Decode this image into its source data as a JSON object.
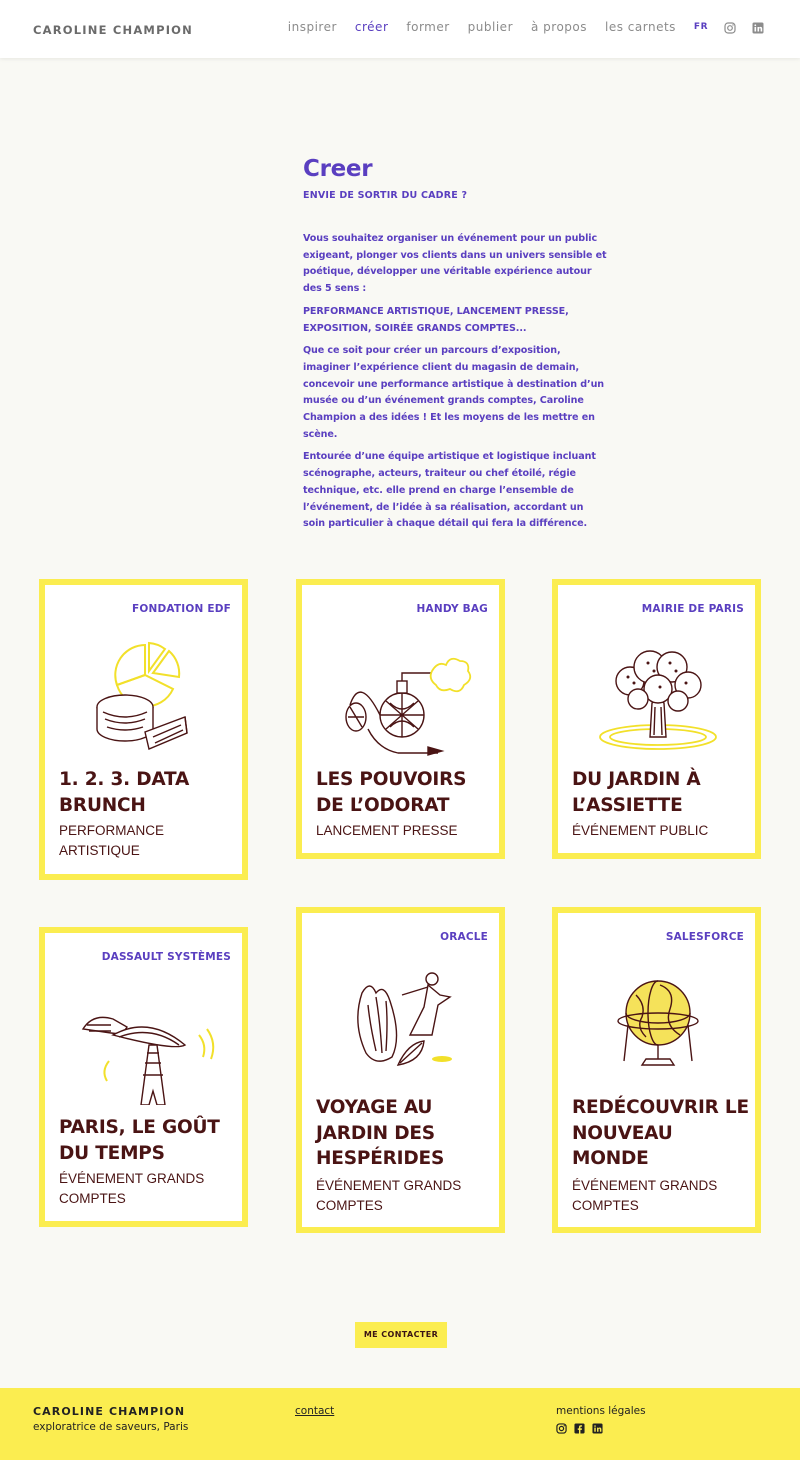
{
  "header": {
    "logo": "CAROLINE CHAMPION",
    "nav": [
      "inspirer",
      "créer",
      "former",
      "publier",
      "à propos",
      "les carnets"
    ],
    "lang": "FR"
  },
  "intro": {
    "title": "Creer",
    "subtitle": "ENVIE DE SORTIR DU CADRE ?",
    "p1": "Vous souhaitez organiser un événement pour un public exigeant, plonger vos clients dans un univers sensible et poétique, développer une véritable expérience autour des 5 sens :",
    "p2": "PERFORMANCE ARTISTIQUE, LANCEMENT PRESSE, EXPOSITION, SOIRÉE GRANDS COMPTES...",
    "p3": "Que ce soit pour créer un parcours d’exposition, imaginer l’expérience client du magasin de demain, concevoir une performance artistique à destination d’un musée ou d’un événement grands comptes, Caroline Champion a des idées ! Et les moyens de les mettre en scène.",
    "p4": "Entourée d’une équipe artistique et logistique incluant scénographe, acteurs, traiteur ou chef étoilé, régie technique, etc. elle prend en charge l’ensemble de l’événement, de l’idée à sa réalisation, accordant un soin particulier à chaque détail qui fera la différence."
  },
  "cards": [
    {
      "client": "FONDATION EDF",
      "title": "1. 2. 3. DATA BRUNCH",
      "type": "PERFORMANCE ARTISTIQUE",
      "icon": "cheese-pie-chart-icon"
    },
    {
      "client": "HANDY BAG",
      "title": "LES POUVOIRS DE L’ODORAT",
      "type": "LANCEMENT PRESSE",
      "icon": "perfume-atomizer-icon"
    },
    {
      "client": "MAIRIE DE PARIS",
      "title": "DU JARDIN À L’ASSIETTE",
      "type": "ÉVÉNEMENT PUBLIC",
      "icon": "broccoli-icon"
    },
    {
      "client": "DASSAULT SYSTÈMES",
      "title": "PARIS, LE GOÛT DU TEMPS",
      "type": "ÉVÉNEMENT GRANDS COMPTES",
      "icon": "cloche-eiffel-tower-icon"
    },
    {
      "client": "ORACLE",
      "title": "VOYAGE AU JARDIN DES HESPÉRIDES",
      "type": "ÉVÉNEMENT GRANDS COMPTES",
      "icon": "citron-goddess-icon"
    },
    {
      "client": "SALESFORCE",
      "title": "REDÉCOUVRIR LE NOUVEAU MONDE",
      "type": "ÉVÉNEMENT GRANDS COMPTES",
      "icon": "globe-icon"
    }
  ],
  "contact_button": "ME CONTACTER",
  "footer": {
    "logo": "CAROLINE CHAMPION",
    "tagline": "exploratrice de saveurs, Paris",
    "contact": "contact",
    "legal": "mentions légales"
  },
  "colors": {
    "accent": "#5a3fc0",
    "yellow": "#fbed50",
    "dark_red": "#4a1414",
    "background": "#f9f9f4"
  }
}
